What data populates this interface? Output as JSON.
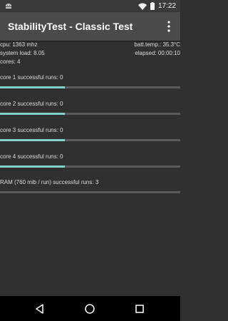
{
  "statusbar": {
    "time": "17:22",
    "icons": [
      "android-debug-icon",
      "wifi-icon",
      "battery-icon"
    ]
  },
  "appbar": {
    "title": "StabilityTest - Classic Test",
    "menu_icon": "overflow-menu-icon"
  },
  "info": {
    "cpu": "cpu: 1363 mhz",
    "batt_temp": "batt.temp.: 35.3°C",
    "system_load": "system load: 8.05",
    "elapsed": "elapsed: 00:00:10",
    "cores": "cores: 4"
  },
  "tests": [
    {
      "label": "core 1 successful runs: 0",
      "progress": 0.36
    },
    {
      "label": "core 2 successful runs: 0",
      "progress": 0.36
    },
    {
      "label": "core 3 successful runs: 0",
      "progress": 0.36
    },
    {
      "label": "core 4 successful runs: 0",
      "progress": 0.36
    },
    {
      "label": "RAM (760 mib / run) successful runs: 3",
      "progress": 0.0
    }
  ],
  "navbar": {
    "icons": [
      "back-icon",
      "home-icon",
      "recents-icon"
    ]
  },
  "colors": {
    "accent": "#7fd3cb",
    "background": "#303030",
    "appbar": "#4a4a4a"
  }
}
